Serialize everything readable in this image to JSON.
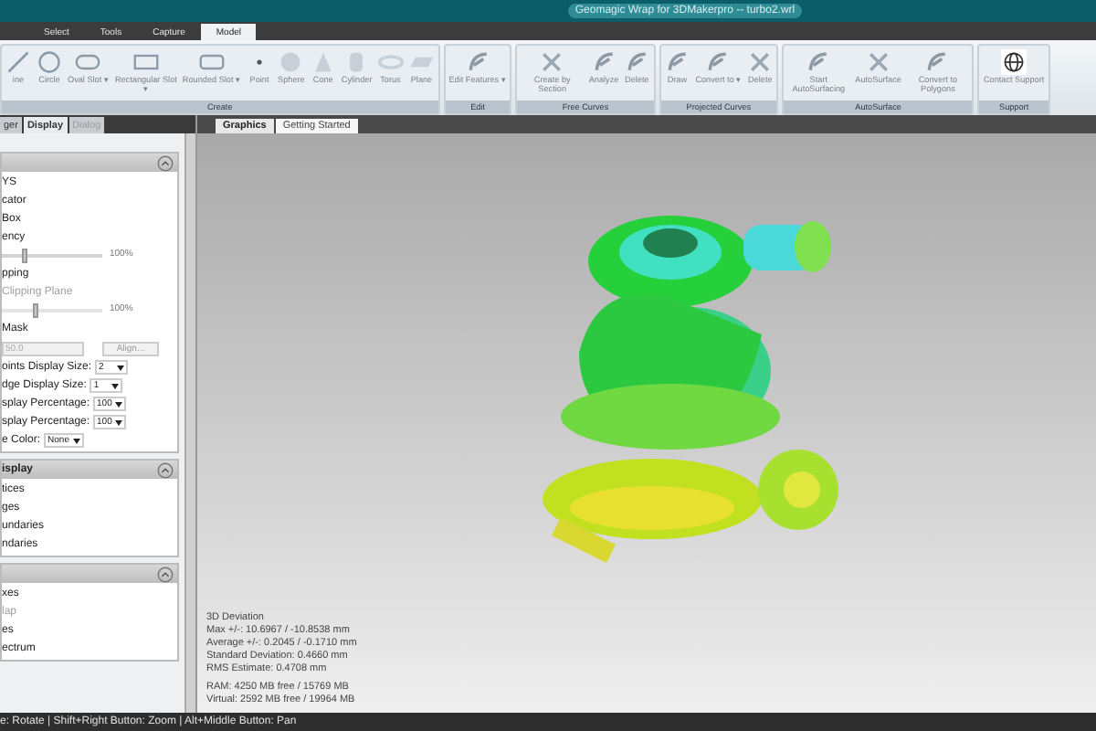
{
  "window": {
    "title": "Geomagic Wrap for 3DMakerpro -- turbo2.wrl"
  },
  "ribbon_tabs": [
    {
      "label": "Select",
      "selected": false
    },
    {
      "label": "Tools",
      "selected": false
    },
    {
      "label": "Capture",
      "selected": false
    },
    {
      "label": "Model",
      "selected": true
    }
  ],
  "ribbon_groups": [
    {
      "title": "Create",
      "items": [
        {
          "label": "ine"
        },
        {
          "label": "Circle"
        },
        {
          "label": "Oval Slot ▾"
        },
        {
          "label": "Rectangular Slot ▾"
        },
        {
          "label": "Rounded Slot ▾"
        },
        {
          "label": "Point"
        },
        {
          "label": "Sphere"
        },
        {
          "label": "Cone"
        },
        {
          "label": "Cylinder"
        },
        {
          "label": "Torus"
        },
        {
          "label": "Plane"
        }
      ]
    },
    {
      "title": "Edit",
      "items": [
        {
          "label": "Edit Features ▾"
        }
      ]
    },
    {
      "title": "Free Curves",
      "items": [
        {
          "label": "Create by Section"
        },
        {
          "label": "Analyze"
        },
        {
          "label": "Delete"
        }
      ]
    },
    {
      "title": "Projected Curves",
      "items": [
        {
          "label": "Draw"
        },
        {
          "label": "Convert to ▾"
        },
        {
          "label": "Delete"
        }
      ]
    },
    {
      "title": "AutoSurface",
      "items": [
        {
          "label": "Start AutoSurfacing"
        },
        {
          "label": "AutoSurface"
        },
        {
          "label": "Convert to Polygons"
        }
      ]
    },
    {
      "title": "Support",
      "items": [
        {
          "label": "Contact Support"
        }
      ]
    }
  ],
  "panel_tabs": [
    {
      "label": "ger",
      "selected": false,
      "disabled": false
    },
    {
      "label": "Display",
      "selected": true,
      "disabled": false
    },
    {
      "label": "Dialog",
      "selected": false,
      "disabled": true
    }
  ],
  "view_tabs": [
    {
      "label": "Graphics",
      "selected": true
    },
    {
      "label": "Getting Started",
      "selected": false
    }
  ],
  "sections": [
    {
      "rows": [
        {
          "kind": "text",
          "label": "YS",
          "disabled": false
        },
        {
          "kind": "text",
          "label": "cator",
          "disabled": false
        },
        {
          "kind": "text",
          "label": "Box",
          "disabled": false
        },
        {
          "kind": "text",
          "label": "ency",
          "disabled": false
        },
        {
          "kind": "slider",
          "level": 0.2,
          "reading": "100%",
          "disabled": false
        },
        {
          "kind": "text",
          "label": "pping",
          "disabled": false
        },
        {
          "kind": "text",
          "label": "Clipping Plane",
          "disabled": true
        },
        {
          "kind": "slider",
          "level": 0.3,
          "reading": "100%",
          "disabled": true
        },
        {
          "kind": "text",
          "label": "Mask",
          "disabled": false
        },
        {
          "kind": "spin",
          "value": "50.0",
          "button": "Align...",
          "disabled": true
        },
        {
          "kind": "select",
          "label": "oints Display Size:",
          "value": "2"
        },
        {
          "kind": "select",
          "label": "dge Display Size:",
          "value": "1"
        },
        {
          "kind": "select",
          "label": "splay Percentage:",
          "value": "100"
        },
        {
          "kind": "select",
          "label": "splay Percentage:",
          "value": "100"
        },
        {
          "kind": "select",
          "label": "e Color:",
          "value": "None"
        }
      ]
    },
    {
      "title": "isplay",
      "rows": [
        {
          "kind": "text",
          "label": "tices",
          "disabled": false
        },
        {
          "kind": "text",
          "label": "ges",
          "disabled": false
        },
        {
          "kind": "text",
          "label": "undaries",
          "disabled": false
        },
        {
          "kind": "text",
          "label": "ndaries",
          "disabled": false
        }
      ]
    },
    {
      "rows": [
        {
          "kind": "text",
          "label": "xes",
          "disabled": false
        },
        {
          "kind": "text",
          "label": "lap",
          "disabled": true
        },
        {
          "kind": "text",
          "label": "es",
          "disabled": false
        },
        {
          "kind": "text",
          "label": "ectrum",
          "disabled": false
        }
      ]
    }
  ],
  "stats": {
    "deviation": [
      "3D Deviation",
      "Max +/-: 10.6967 / -10.8538 mm",
      "Average +/-: 0.2045 / -0.1710 mm",
      "Standard Deviation: 0.4660 mm",
      "RMS Estimate: 0.4708 mm"
    ],
    "memory": [
      "RAM: 4250 MB free / 15769 MB",
      "Virtual: 2592 MB free / 19964 MB"
    ]
  },
  "status_bar": "e: Rotate | Shift+Right Button: Zoom | Alt+Middle Button: Pan"
}
